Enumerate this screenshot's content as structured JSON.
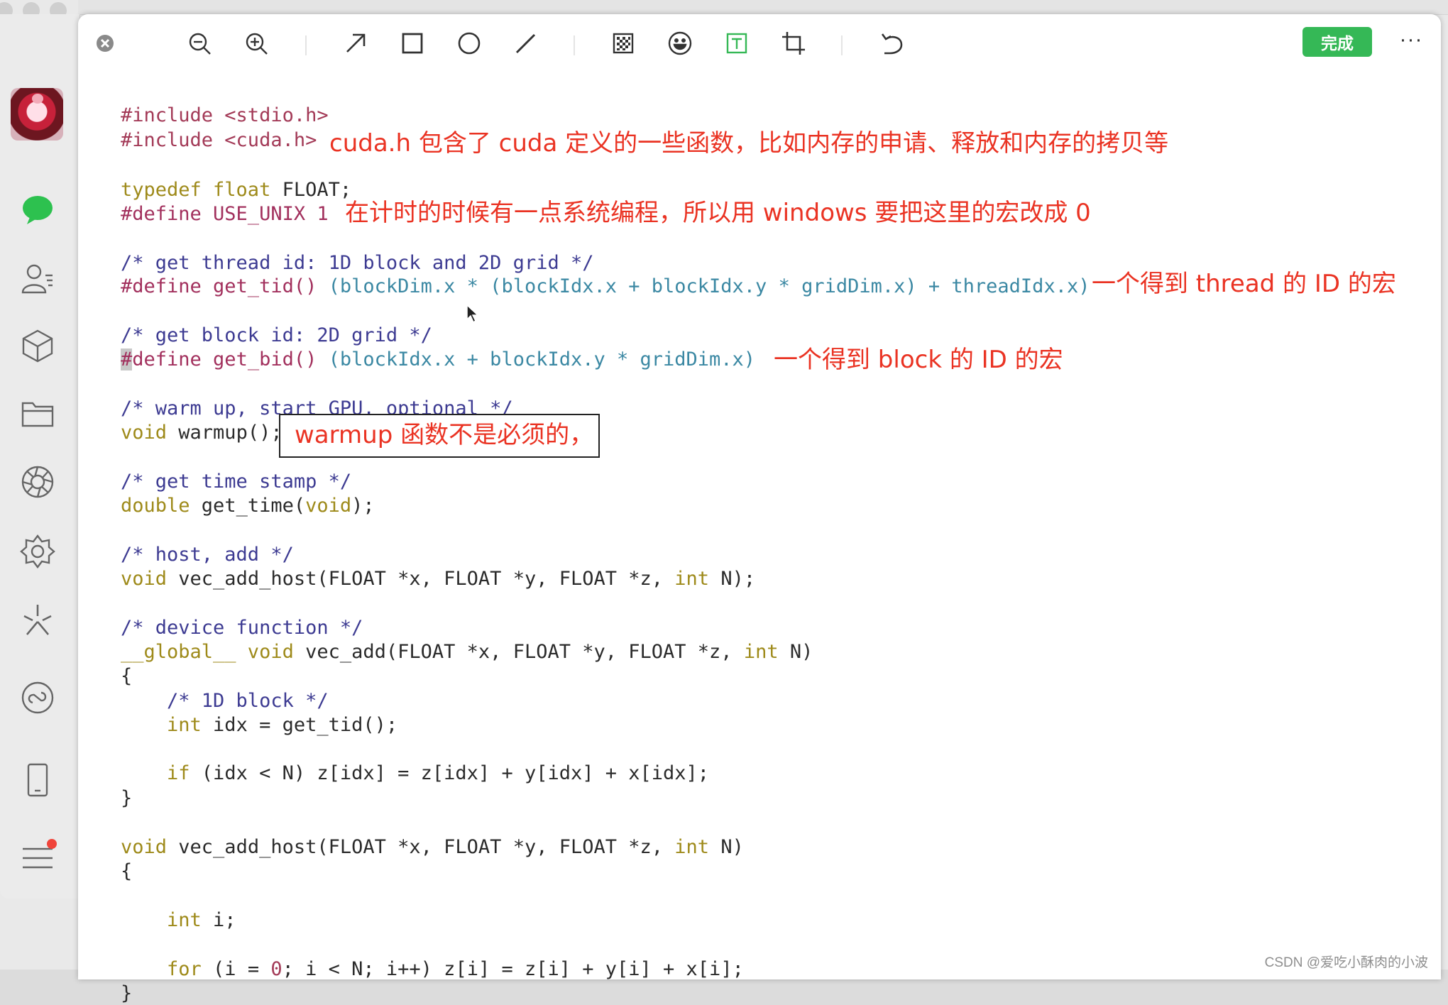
{
  "sidebar": {
    "avatar_alt": "user avatar",
    "items": [
      {
        "name": "chat",
        "icon": "chat-bubble-icon"
      },
      {
        "name": "contacts",
        "icon": "contacts-icon"
      },
      {
        "name": "mini-programs",
        "icon": "cube-icon"
      },
      {
        "name": "files",
        "icon": "folder-icon"
      },
      {
        "name": "moments",
        "icon": "aperture-icon"
      },
      {
        "name": "channels",
        "icon": "gear-flower-icon"
      },
      {
        "name": "look",
        "icon": "sparkle-icon"
      },
      {
        "name": "search",
        "icon": "miniapp-icon"
      },
      {
        "name": "phone",
        "icon": "phone-icon"
      },
      {
        "name": "menu",
        "icon": "menu-icon"
      }
    ]
  },
  "toolbar": {
    "done_label": "完成",
    "more_label": "···",
    "accent": "#35b856"
  },
  "code": {
    "l1": "#include <stdio.h>",
    "l2": "#include <cuda.h>",
    "l3a": "typedef float",
    "l3b": " FLOAT;",
    "l4a": "#define USE_UNIX 1",
    "l5": "/* get thread id: 1D block and 2D grid */",
    "l6a": "#define get_tid() ",
    "l6b": "(blockDim.x * (blockIdx.x + blockIdx.y * gridDim.x) + threadIdx.x)",
    "l7": "/* get block id: 2D grid */",
    "l8hash": "#",
    "l8a": "define get_bid() ",
    "l8b": "(blockIdx.x + blockIdx.y * gridDim.x)",
    "l9": "/* warm up, start GPU, optional */",
    "l10a": "void",
    "l10b": " warmup();",
    "l11": "/* get time stamp */",
    "l12a": "double",
    "l12b": " get_time(",
    "l12c": "void",
    "l12d": ");",
    "l13": "/* host, add */",
    "l14a": "void",
    "l14b": " vec_add_host(FLOAT *x, FLOAT *y, FLOAT *z, ",
    "l14c": "int",
    "l14d": " N);",
    "l15": "/* device function */",
    "l16a": "__global__ void",
    "l16b": " vec_add(FLOAT *x, FLOAT *y, FLOAT *z, ",
    "l16c": "int",
    "l16d": " N)",
    "l17": "{",
    "l18": "    /* 1D block */",
    "l19a": "    int",
    "l19b": " idx = get_tid();",
    "l20a": "    if",
    "l20b": " (idx < N) z[idx] = z[idx] + y[idx] + x[idx];",
    "l21": "}",
    "l22a": "void",
    "l22b": " vec_add_host(FLOAT *x, FLOAT *y, FLOAT *z, ",
    "l22c": "int",
    "l22d": " N)",
    "l23": "{",
    "l24a": "    int",
    "l24b": " i;",
    "l25a": "    for",
    "l25b": " (i = ",
    "l25c": "0",
    "l25d": "; i < N; i++) z[i] = z[i] + y[i] + x[i];",
    "l26": "}"
  },
  "annotations": {
    "a1": "cuda.h 包含了 cuda 定义的一些函数，比如内存的申请、释放和内存的拷贝等",
    "a2": "在计时的时候有一点系统编程，所以用 windows 要把这里的宏改成 0",
    "a3": "一个得到 thread 的 ID 的宏",
    "a4": "一个得到 block 的 ID 的宏",
    "a5": "warmup 函数不是必须的，"
  },
  "watermark": "CSDN @爱吃小酥肉的小波"
}
